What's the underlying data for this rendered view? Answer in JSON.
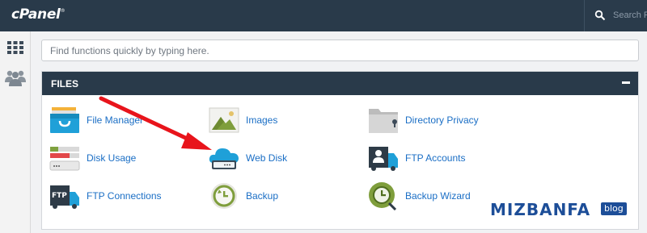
{
  "header": {
    "logo": "cPanel",
    "logo_mark": "®",
    "search_placeholder": "Search Fe"
  },
  "quick_search": {
    "placeholder": "Find functions quickly by typing here."
  },
  "section": {
    "title": "FILES",
    "items": [
      {
        "label": "File Manager",
        "icon": "file-manager-icon"
      },
      {
        "label": "Images",
        "icon": "images-icon"
      },
      {
        "label": "Directory Privacy",
        "icon": "directory-privacy-icon"
      },
      {
        "label": "Disk Usage",
        "icon": "disk-usage-icon"
      },
      {
        "label": "Web Disk",
        "icon": "web-disk-icon"
      },
      {
        "label": "FTP Accounts",
        "icon": "ftp-accounts-icon"
      },
      {
        "label": "FTP Connections",
        "icon": "ftp-connections-icon"
      },
      {
        "label": "Backup",
        "icon": "backup-icon"
      },
      {
        "label": "Backup Wizard",
        "icon": "backup-wizard-icon"
      }
    ]
  },
  "watermark": {
    "text": "MIZBANFA",
    "tag": "blog"
  },
  "colors": {
    "header_bg": "#293a4a",
    "link": "#1a6ec5",
    "arrow": "#e8141b",
    "watermark": "#1d4e98"
  }
}
